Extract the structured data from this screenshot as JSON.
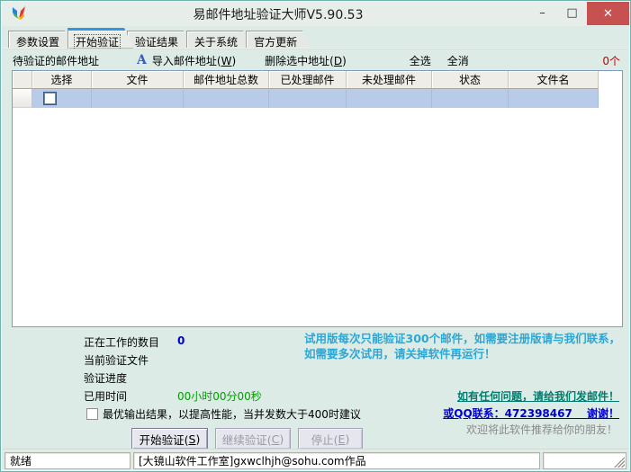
{
  "window": {
    "title": "易邮件地址验证大师V5.90.53",
    "controls": {
      "minimize": "–",
      "maximize": "□",
      "close": "✕"
    }
  },
  "tabs": [
    {
      "label": "参数设置"
    },
    {
      "label": "开始验证"
    },
    {
      "label": "验证结果"
    },
    {
      "label": "关于系统"
    },
    {
      "label": "官方更新"
    }
  ],
  "toolbar": {
    "list_label": "待验证的邮件地址",
    "import_icon": "A",
    "import_prefix": "导入邮件地址(",
    "import_mnemonic": "W",
    "import_suffix": ")",
    "delete_prefix": "删除选中地址(",
    "delete_mnemonic": "D",
    "delete_suffix": ")",
    "select_all": "全选",
    "deselect_all": "全消",
    "count": "0个"
  },
  "table": {
    "headers": [
      "选择",
      "文件",
      "邮件地址总数",
      "已处理邮件",
      "未处理邮件",
      "状态",
      "文件名"
    ],
    "row": {
      "selected": true,
      "checkbox_checked": false
    }
  },
  "info": {
    "working_label": "正在工作的数目",
    "working_value": "0",
    "current_file_label": "当前验证文件",
    "progress_label": "验证进度",
    "elapsed_label": "已用时间",
    "elapsed_value": "00小时00分00秒"
  },
  "trial": {
    "notice": "试用版每次只能验证300个邮件，如需要注册版请与我们联系，如需要多次试用，请关掉软件再运行！",
    "contact_email": "如有任何问题，请给我们发邮件！",
    "contact_qq": "或QQ联系：472398467　 谢谢！",
    "recommend": "欢迎将此软件推荐给你的朋友！"
  },
  "optimize": {
    "label": "最优输出结果，以提高性能，当并发数大于400时建议",
    "checked": false
  },
  "buttons": {
    "start_prefix": "开始验证(",
    "start_mnemonic": "S",
    "start_suffix": ")",
    "continue_prefix": "继续验证(",
    "continue_mnemonic": "C",
    "continue_suffix": ")",
    "stop_prefix": "停止(",
    "stop_mnemonic": "E",
    "stop_suffix": ")"
  },
  "statusbar": {
    "ready": "就绪",
    "credit": "[大镜山软件工作室]gxwclhjh@sohu.com作品"
  },
  "colors": {
    "close_button": "#c75050",
    "active_tab_top": "#2f96e8",
    "selected_row": "#b8cbe8",
    "count_red": "#c00000",
    "value_blue": "#0000cc",
    "time_green": "#00a000",
    "trial_teal_blue": "#2ba7d6",
    "email_link_green": "#007d6e",
    "qq_link_blue": "#0000cc",
    "window_frame": "#dcebe6"
  }
}
